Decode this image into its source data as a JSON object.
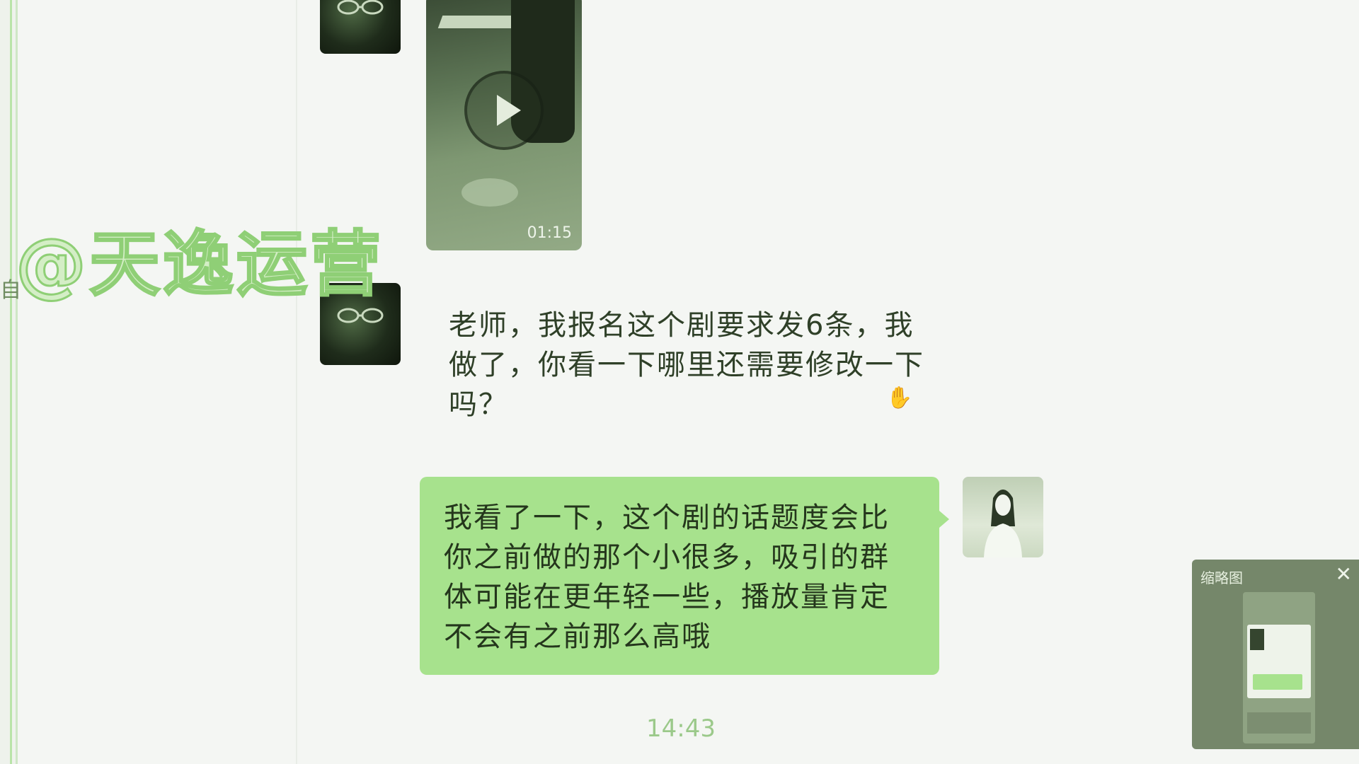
{
  "watermark": "@天逸运营",
  "sidebar": {
    "partial_text": "自"
  },
  "video": {
    "duration": "01:15"
  },
  "messages": {
    "received": "老师，我报名这个剧要求发6条，我做了，你看一下哪里还需要修改一下吗？",
    "sent": "我看了一下，这个剧的话题度会比你之前做的那个小很多，吸引的群体可能在更年轻一些，播放量肯定不会有之前那么高哦",
    "timestamp": "14:43"
  },
  "thumbnail_panel": {
    "title": "缩略图",
    "close_icon": "close-icon"
  },
  "colors": {
    "background": "#f4f6f3",
    "sent_bubble": "#a7e28d",
    "timestamp": "#9bc98a",
    "watermark_stroke": "#8fcf76"
  }
}
